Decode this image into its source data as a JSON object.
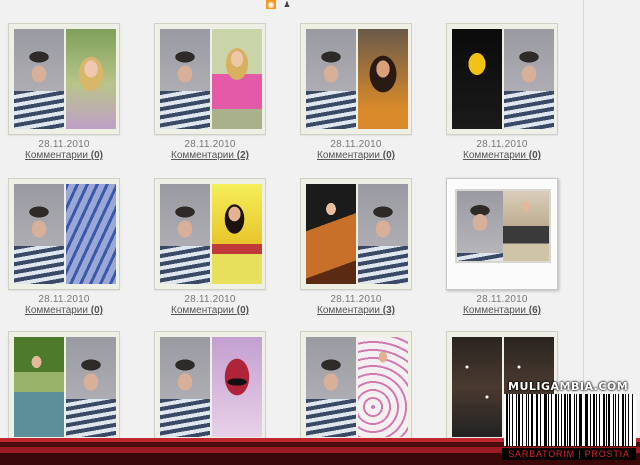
{
  "toolbar": {
    "rss_icon": "rss-icon",
    "user_icon": "user-icon"
  },
  "photos": [
    {
      "left": "boy",
      "right": "girl-blond",
      "date": "28.11.2010",
      "comments_label": "Комментарии",
      "comments_count": "(0)"
    },
    {
      "left": "boy",
      "right": "girl-pink",
      "date": "28.11.2010",
      "comments_label": "Комментарии",
      "comments_count": "(2)"
    },
    {
      "left": "boy",
      "right": "girl-dark",
      "date": "28.11.2010",
      "comments_label": "Комментарии",
      "comments_count": "(0)"
    },
    {
      "left": "girl-yellow",
      "right": "boy",
      "date": "28.11.2010",
      "comments_label": "Комментарии",
      "comments_count": "(0)"
    },
    {
      "left": "boy",
      "right": "girl-shoe",
      "date": "28.11.2010",
      "comments_label": "Комментарии",
      "comments_count": "(0)"
    },
    {
      "left": "boy",
      "right": "girl-yellowbg",
      "date": "28.11.2010",
      "comments_label": "Комментарии",
      "comments_count": "(0)"
    },
    {
      "left": "girl-wood",
      "right": "boy",
      "date": "28.11.2010",
      "comments_label": "Комментарии",
      "comments_count": "(3)"
    },
    {
      "left": "boy",
      "right": "girl-wall",
      "date": "28.11.2010",
      "comments_label": "Комментарии",
      "comments_count": "(6)",
      "polaroid": true
    },
    {
      "left": "girl-lake",
      "right": "boy",
      "date": "",
      "comments_label": "",
      "comments_count": ""
    },
    {
      "left": "boy",
      "right": "girl-glasses",
      "date": "",
      "comments_label": "",
      "comments_count": ""
    },
    {
      "left": "boy",
      "right": "girl-floral",
      "date": "",
      "comments_label": "",
      "comments_count": ""
    },
    {
      "left": "collage",
      "right": "collage",
      "date": "",
      "comments_label": "",
      "comments_count": ""
    }
  ],
  "watermark": {
    "site": "MULIGAMBIA.COM",
    "tagline": "SARBATORIM | PROSTIA",
    "icon": "barcode-icon"
  },
  "colors": {
    "accent_red": "#c0262e",
    "link_gray": "#555555",
    "rss_orange": "#f39a1d"
  }
}
